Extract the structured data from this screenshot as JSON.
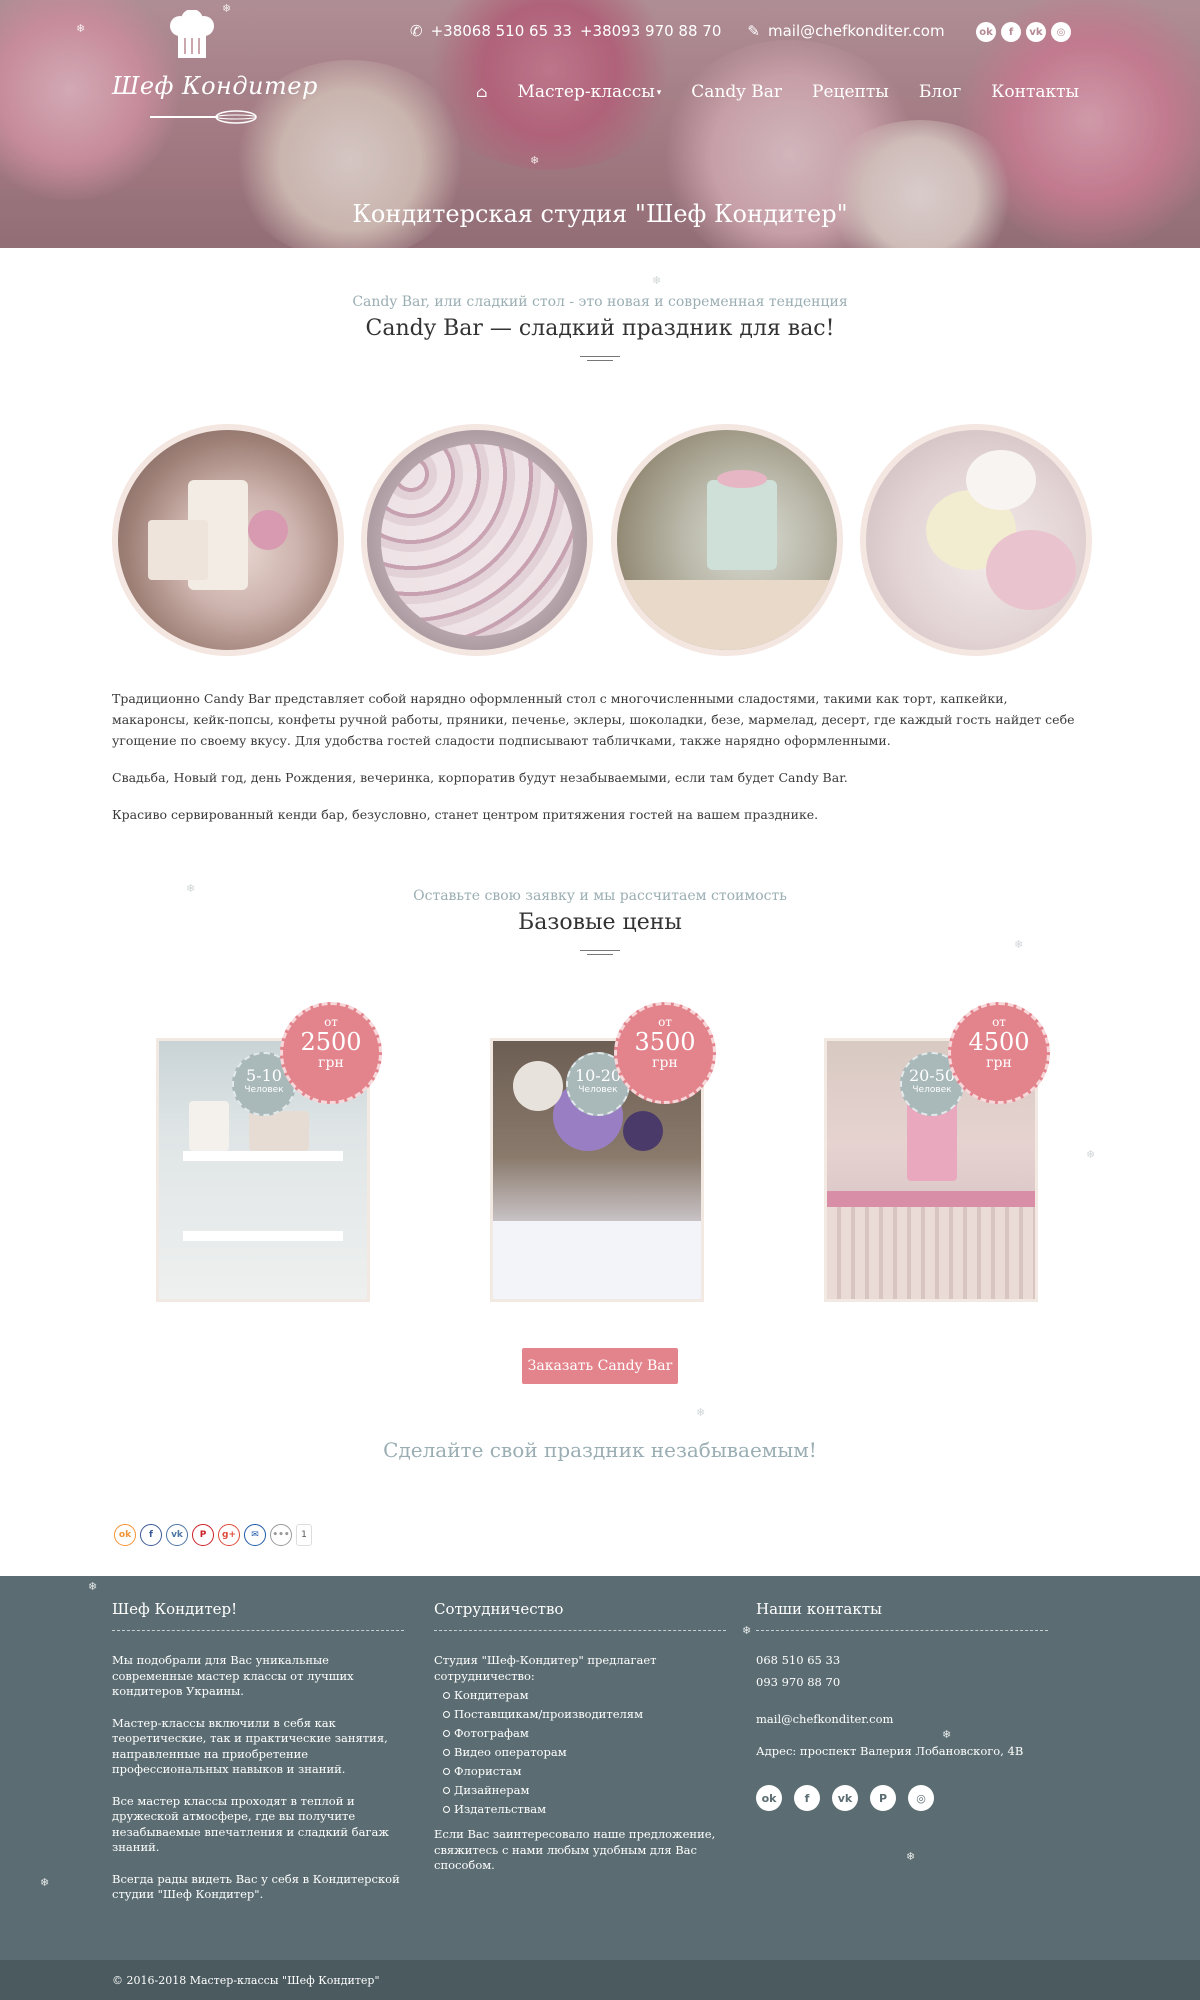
{
  "header": {
    "logo_text": "Шеф Кондитер",
    "phone1": "+38068 510 65 33",
    "phone2": "+38093 970 88 70",
    "email": "mail@chefkonditer.com",
    "nav": [
      "Мастер-классы",
      "Candy Bar",
      "Рецепты",
      "Блог",
      "Контакты"
    ],
    "social_icons": [
      "odnoklassniki-icon",
      "facebook-icon",
      "vk-icon",
      "instagram-icon"
    ],
    "hero_title": "Кондитерская студия \"Шеф Кондитер\""
  },
  "intro": {
    "subtitle": "Candy Bar, или сладкий стол - это новая и современная тенденция",
    "title": "Candy Bar — сладкий праздник для вас!",
    "paragraphs": [
      "Традиционно Candy Bar представляет собой нарядно оформленный стол с многочисленными сладостями, такими как торт, капкейки, макаронсы, кейк-попсы, конфеты ручной работы, пряники, печенье, эклеры, шоколадки, безе, мармелад, десерт, где каждый гость найдет себе угощение по своему вкусу. Для удобства гостей сладости подписывают табличками, также нарядно оформленными.",
      "Свадьба, Новый год, день Рождения, вечеринка, корпоратив будут незабываемыми, если там будет Candy Bar.",
      "Красиво сервированный кенди бар, безусловно, станет центром притяжения гостей на вашем празднике."
    ]
  },
  "prices": {
    "subtitle": "Оставьте свою заявку и мы рассчитаем стоимость",
    "title": "Базовые цены",
    "items": [
      {
        "from": "от",
        "amount": "2500",
        "currency": "грн",
        "range": "5-10",
        "unit": "Человек"
      },
      {
        "from": "от",
        "amount": "3500",
        "currency": "грн",
        "range": "10-20",
        "unit": "Человек"
      },
      {
        "from": "от",
        "amount": "4500",
        "currency": "грн",
        "range": "20-50",
        "unit": "Человек"
      }
    ],
    "order_button": "Заказать Candy Bar"
  },
  "slogan": "Сделайте свой праздник незабываемым!",
  "share": {
    "icons": [
      "odnoklassniki-icon",
      "facebook-icon",
      "vk-icon",
      "pinterest-icon",
      "google-plus-icon",
      "email-icon",
      "more-icon"
    ],
    "count": "1"
  },
  "footer": {
    "col1": {
      "title": "Шеф Кондитер!",
      "paragraphs": [
        "Мы подобрали для Вас уникальные современные мастер классы от лучших кондитеров Украины.",
        "Мастер-классы включили в себя как теоретические, так и практические занятия, направленные на приобретение профессиональных навыков и знаний.",
        "Все мастер классы проходят в теплой и дружеской атмосфере, где вы получите незабываемые впечатления и сладкий багаж знаний.",
        "Всегда рады видеть Вас у себя в Кондитерской студии \"Шеф Кондитер\"."
      ]
    },
    "col2": {
      "title": "Сотрудничество",
      "intro": "Студия \"Шеф-Кондитер\" предлагает сотрудничество:",
      "items": [
        "Кондитерам",
        "Поставщикам/производителям",
        "Фотографам",
        "Видео операторам",
        "Флористам",
        "Дизайнерам",
        "Издательствам"
      ],
      "outro": "Если Вас заинтересовало наше предложение, свяжитесь с нами любым удобным для Вас способом."
    },
    "col3": {
      "title": "Наши контакты",
      "phone1": "068 510 65 33",
      "phone2": "093 970 88 70",
      "email": "mail@chefkonditer.com",
      "address": "Адрес: проспект Валерия Лобановского, 4В",
      "social_icons": [
        "odnoklassniki-icon",
        "facebook-icon",
        "vk-icon",
        "pinterest-icon",
        "instagram-icon"
      ]
    },
    "copyright": "© 2016-2018 Мастер-классы \"Шеф Кондитер\""
  },
  "colors": {
    "accent": "#e3848c",
    "muted_teal": "#9aaeb3",
    "footer_bg": "#5b6d72",
    "bottom_bar": "#4a5a5f"
  }
}
